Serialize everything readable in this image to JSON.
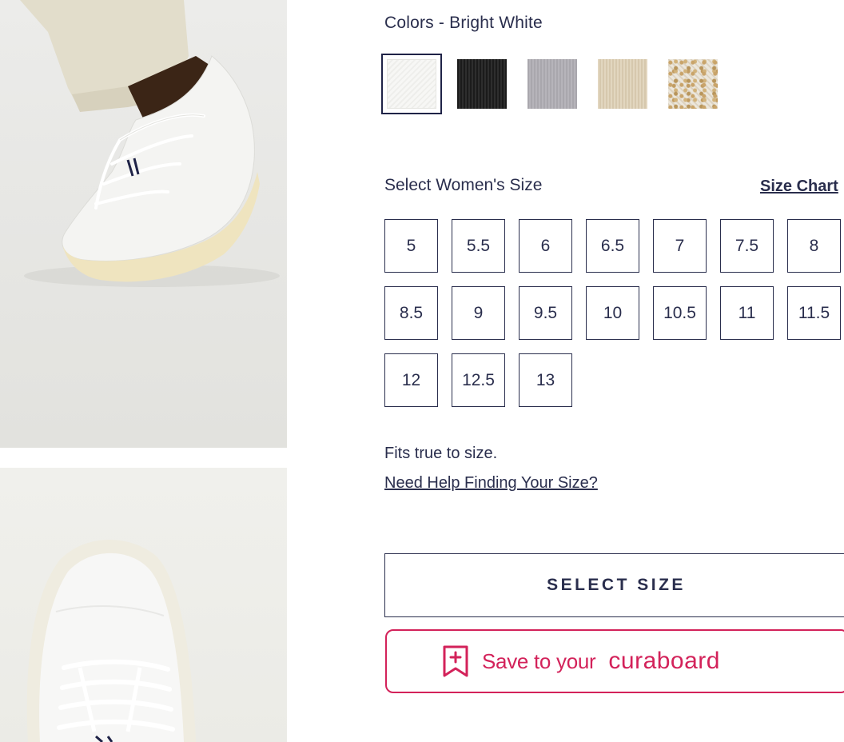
{
  "colors": {
    "label": "Colors - Bright White",
    "swatches": [
      {
        "name": "Bright White",
        "selected": true
      },
      {
        "name": "Black",
        "selected": false
      },
      {
        "name": "Grey",
        "selected": false
      },
      {
        "name": "Tan",
        "selected": false
      },
      {
        "name": "Speckled",
        "selected": false
      }
    ]
  },
  "size": {
    "label": "Select Women's Size",
    "chart_link": "Size Chart",
    "options": [
      "5",
      "5.5",
      "6",
      "6.5",
      "7",
      "7.5",
      "8",
      "8.5",
      "9",
      "9.5",
      "10",
      "10.5",
      "11",
      "11.5",
      "12",
      "12.5",
      "13"
    ]
  },
  "fit_note": "Fits true to size.",
  "help_link": "Need Help Finding Your Size?",
  "select_button": "SELECT SIZE",
  "save_button": {
    "text": "Save to your",
    "brand": "curaboard",
    "icon": "bookmark-plus-icon"
  },
  "theme": {
    "ink": "#2a2e4d",
    "accent": "#d3225a"
  }
}
